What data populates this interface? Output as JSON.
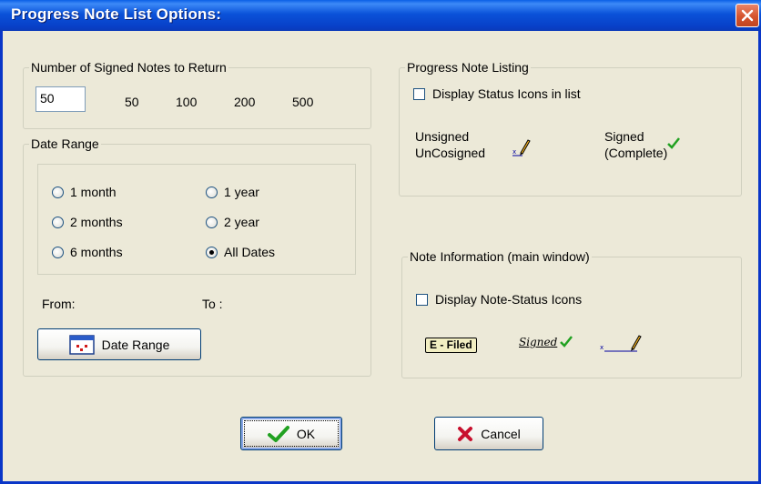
{
  "window": {
    "title": "Progress Note List Options:"
  },
  "signed_notes": {
    "group_label": "Number of Signed Notes to Return",
    "value": "50",
    "presets": [
      "50",
      "100",
      "200",
      "500"
    ]
  },
  "date_range": {
    "group_label": "Date Range",
    "options": [
      {
        "label": "1 month",
        "selected": false
      },
      {
        "label": "1 year",
        "selected": false
      },
      {
        "label": "2 months",
        "selected": false
      },
      {
        "label": "2 year",
        "selected": false
      },
      {
        "label": "6 months",
        "selected": false
      },
      {
        "label": "All Dates",
        "selected": true
      }
    ],
    "from_label": "From:",
    "to_label": "To :",
    "button_label": "Date Range"
  },
  "progress_note_listing": {
    "group_label": "Progress Note Listing",
    "checkbox_label": "Display Status Icons in list",
    "checked": false,
    "unsigned_label_line1": "Unsigned",
    "unsigned_label_line2": "UnCosigned",
    "signed_label_line1": "Signed",
    "signed_label_line2": "(Complete)"
  },
  "note_information": {
    "group_label": "Note Information (main window)",
    "checkbox_label": "Display Note-Status Icons",
    "checked": false,
    "filed_badge": "E - Filed",
    "signed_text": "Signed"
  },
  "buttons": {
    "ok_label": "OK",
    "cancel_label": "Cancel"
  },
  "colors": {
    "titlebar": "#0A52D9",
    "dialog_bg": "#ECE9D8",
    "close_button": "#D5542E",
    "check_green": "#21A121",
    "cancel_red": "#C8102E"
  },
  "icons": [
    "close-icon",
    "calendar-icon",
    "checkmark-icon",
    "x-icon",
    "pencil-icon"
  ]
}
